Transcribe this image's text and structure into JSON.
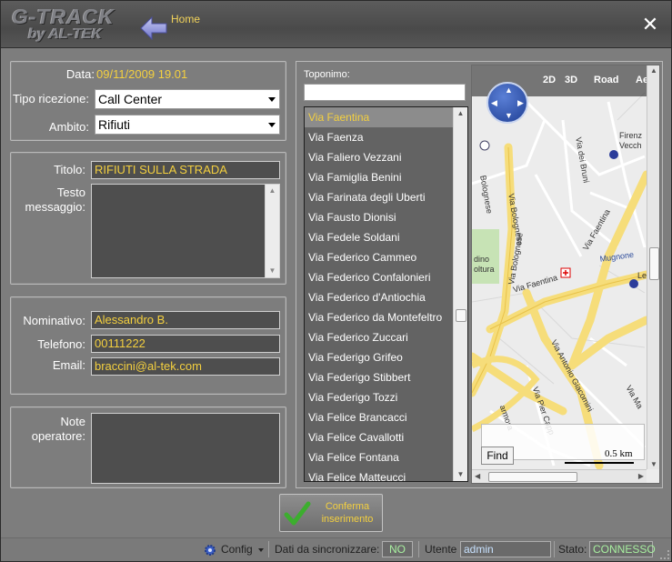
{
  "header": {
    "logo_main": "G-TRACK",
    "logo_sub": "by AL-TEK",
    "home_label": "Home",
    "close_glyph": "✕",
    "icons": {
      "home": "back-arrow-icon",
      "close": "close-icon"
    }
  },
  "form": {
    "data_label": "Data:",
    "data_value": "09/11/2009 19.01",
    "tipo_label": "Tipo ricezione:",
    "tipo_value": "Call Center",
    "ambito_label": "Ambito:",
    "ambito_value": "Rifiuti",
    "titolo_label": "Titolo:",
    "titolo_value": "RIFIUTI SULLA STRADA",
    "testo_label_1": "Testo",
    "testo_label_2": "messaggio:",
    "nominativo_label": "Nominativo:",
    "nominativo_value": "Alessandro B.",
    "telefono_label": "Telefono:",
    "telefono_value": "00111222",
    "email_label": "Email:",
    "email_value": "braccini@al-tek.com",
    "note_label_1": "Note",
    "note_label_2": "operatore:"
  },
  "toponimo": {
    "label": "Toponimo:",
    "streets": [
      "Via Faentina",
      "Via Faenza",
      "Via Faliero Vezzani",
      "Via Famiglia Benini",
      "Via Farinata degli Uberti",
      "Via Fausto Dionisi",
      "Via Fedele Soldani",
      "Via Federico Cammeo",
      "Via Federico Confalonieri",
      "Via Federico d'Antiochia",
      "Via Federico da Montefeltro",
      "Via Federico Zuccari",
      "Via Federigo Grifeo",
      "Via Federigo Stibbert",
      "Via Federigo Tozzi",
      "Via Felice Brancacci",
      "Via Felice Cavallotti",
      "Via Felice Fontana",
      "Via Felice Matteucci"
    ],
    "selected_index": 0
  },
  "map": {
    "tabs": [
      "2D",
      "3D",
      "Road",
      "Ae"
    ],
    "active_tab": "Road",
    "labels": {
      "firenze": "Firenz",
      "vecchio": "Vecch",
      "bologna_top": "Bolognese",
      "via_bolognese_1": "Via Bolognese",
      "via_bolognese_2": "Via Bolognese",
      "via_dei_bruni": "Via dei Bruni",
      "via_faentina_1": "Via Faentina",
      "via_faentina_2": "Via Faentina",
      "mugnone": "Mugnone",
      "dino": "dino",
      "oltura": "oltura",
      "via_antonio": "Via Antonio Giacomini",
      "via_pier": "Via Pier Capp",
      "armora": "armora",
      "l_cut": "Le",
      "via_ma": "Via Ma"
    },
    "find_label": "Find",
    "scale": "0.5 km",
    "icons": [
      "compass-pan-icon",
      "zoom-icon",
      "hospital-icon",
      "bus-icon"
    ]
  },
  "confirm": {
    "label_1": "Conferma",
    "label_2": "inserimento",
    "icon": "check-icon"
  },
  "statusbar": {
    "config_label": "Config",
    "sync_label": "Dati da sincronizzare:",
    "sync_value": "NO",
    "user_label": "Utente",
    "user_value": "admin",
    "state_label": "Stato:",
    "state_value": "CONNESSO",
    "icons": [
      "gear-icon",
      "dropdown-icon"
    ]
  },
  "colors": {
    "accent_yellow": "#f4d03f",
    "status_green": "#a8f0a0",
    "user_blue": "#c8e2ff",
    "panel_gray": "#7d7d7d"
  }
}
